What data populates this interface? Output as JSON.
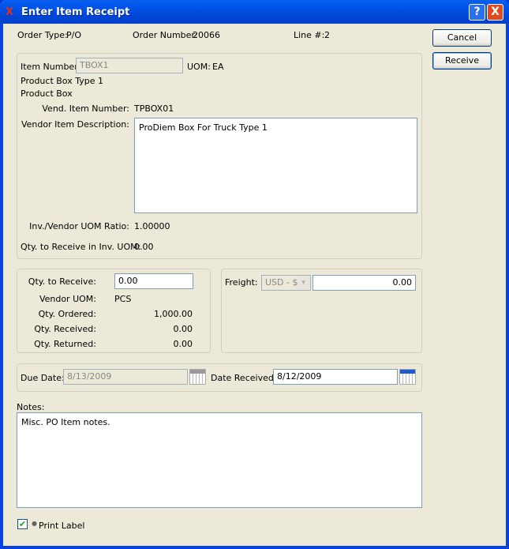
{
  "window": {
    "title": "Enter Item Receipt",
    "help": "?",
    "close": "X"
  },
  "header": {
    "order_type_label": "Order Type:",
    "order_type": "P/O",
    "order_number_label": "Order Number:",
    "order_number": "20066",
    "line_label": "Line #:",
    "line": "2"
  },
  "buttons": {
    "cancel": "Cancel",
    "receive": "Receive"
  },
  "item": {
    "item_number_label": "Item Number:",
    "item_number": "TBOX1",
    "uom_label": "UOM:",
    "uom": "EA",
    "description1": "Product Box Type 1",
    "description2": "Product Box",
    "vend_item_number_label": "Vend. Item Number:",
    "vend_item_number": "TPBOX01",
    "vendor_item_description_label": "Vendor Item Description:",
    "vendor_item_description": "ProDiem Box For Truck Type 1",
    "ratio_label": "Inv./Vendor UOM Ratio:",
    "ratio": "1.00000",
    "qty_inv_uom_label": "Qty. to Receive in Inv. UOM:",
    "qty_inv_uom": "0.00"
  },
  "qty": {
    "to_receive_label": "Qty. to Receive:",
    "to_receive": "0.00",
    "vendor_uom_label": "Vendor UOM:",
    "vendor_uom": "PCS",
    "ordered_label": "Qty. Ordered:",
    "ordered": "1,000.00",
    "received_label": "Qty. Received:",
    "received": "0.00",
    "returned_label": "Qty. Returned:",
    "returned": "0.00"
  },
  "freight": {
    "label": "Freight:",
    "currency": "USD - $",
    "amount": "0.00"
  },
  "dates": {
    "due_label": "Due Date:",
    "due": "8/13/2009",
    "received_label": "Date Received:",
    "received": "8/12/2009"
  },
  "notes": {
    "label": "Notes:",
    "value": "Misc. PO Item notes."
  },
  "print_label": {
    "label": "Print Label",
    "checked": true,
    "check": "✔"
  }
}
